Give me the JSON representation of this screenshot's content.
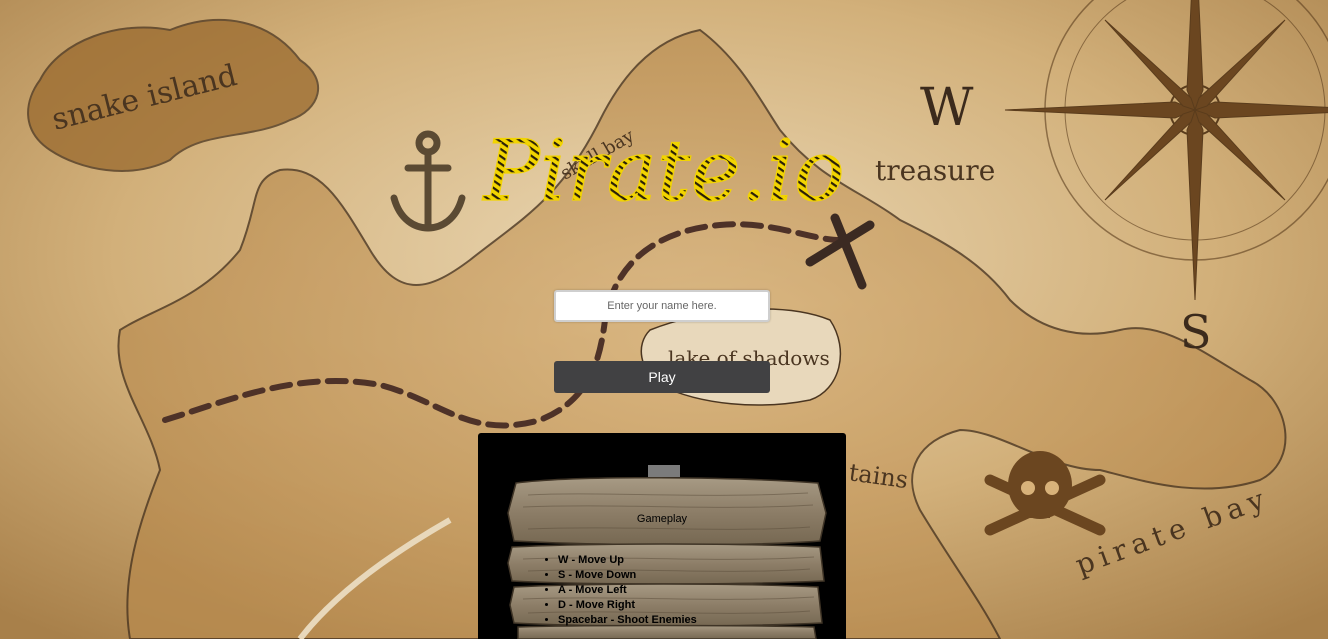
{
  "game": {
    "logo_text": "Pirate.io"
  },
  "map_labels": {
    "snake_island": "snake island",
    "skull_bay": "skull bay",
    "treasure": "treasure",
    "lake": "lake of shadows",
    "mountains": "tains",
    "pirate_bay": "pirate bay",
    "compass_w": "W",
    "compass_s": "S"
  },
  "login": {
    "name_placeholder": "Enter your name here.",
    "name_value": "",
    "play_label": "Play"
  },
  "instructions": {
    "heading": "Gameplay",
    "controls": [
      "W - Move Up",
      "S - Move Down",
      "A - Move Left",
      "D - Move Right",
      "Spacebar - Shoot Enemies"
    ]
  },
  "colors": {
    "parchment": "#c9a672",
    "logo_yellow": "#f2d400",
    "button_bg": "#414143",
    "panel_bg": "#000000"
  }
}
